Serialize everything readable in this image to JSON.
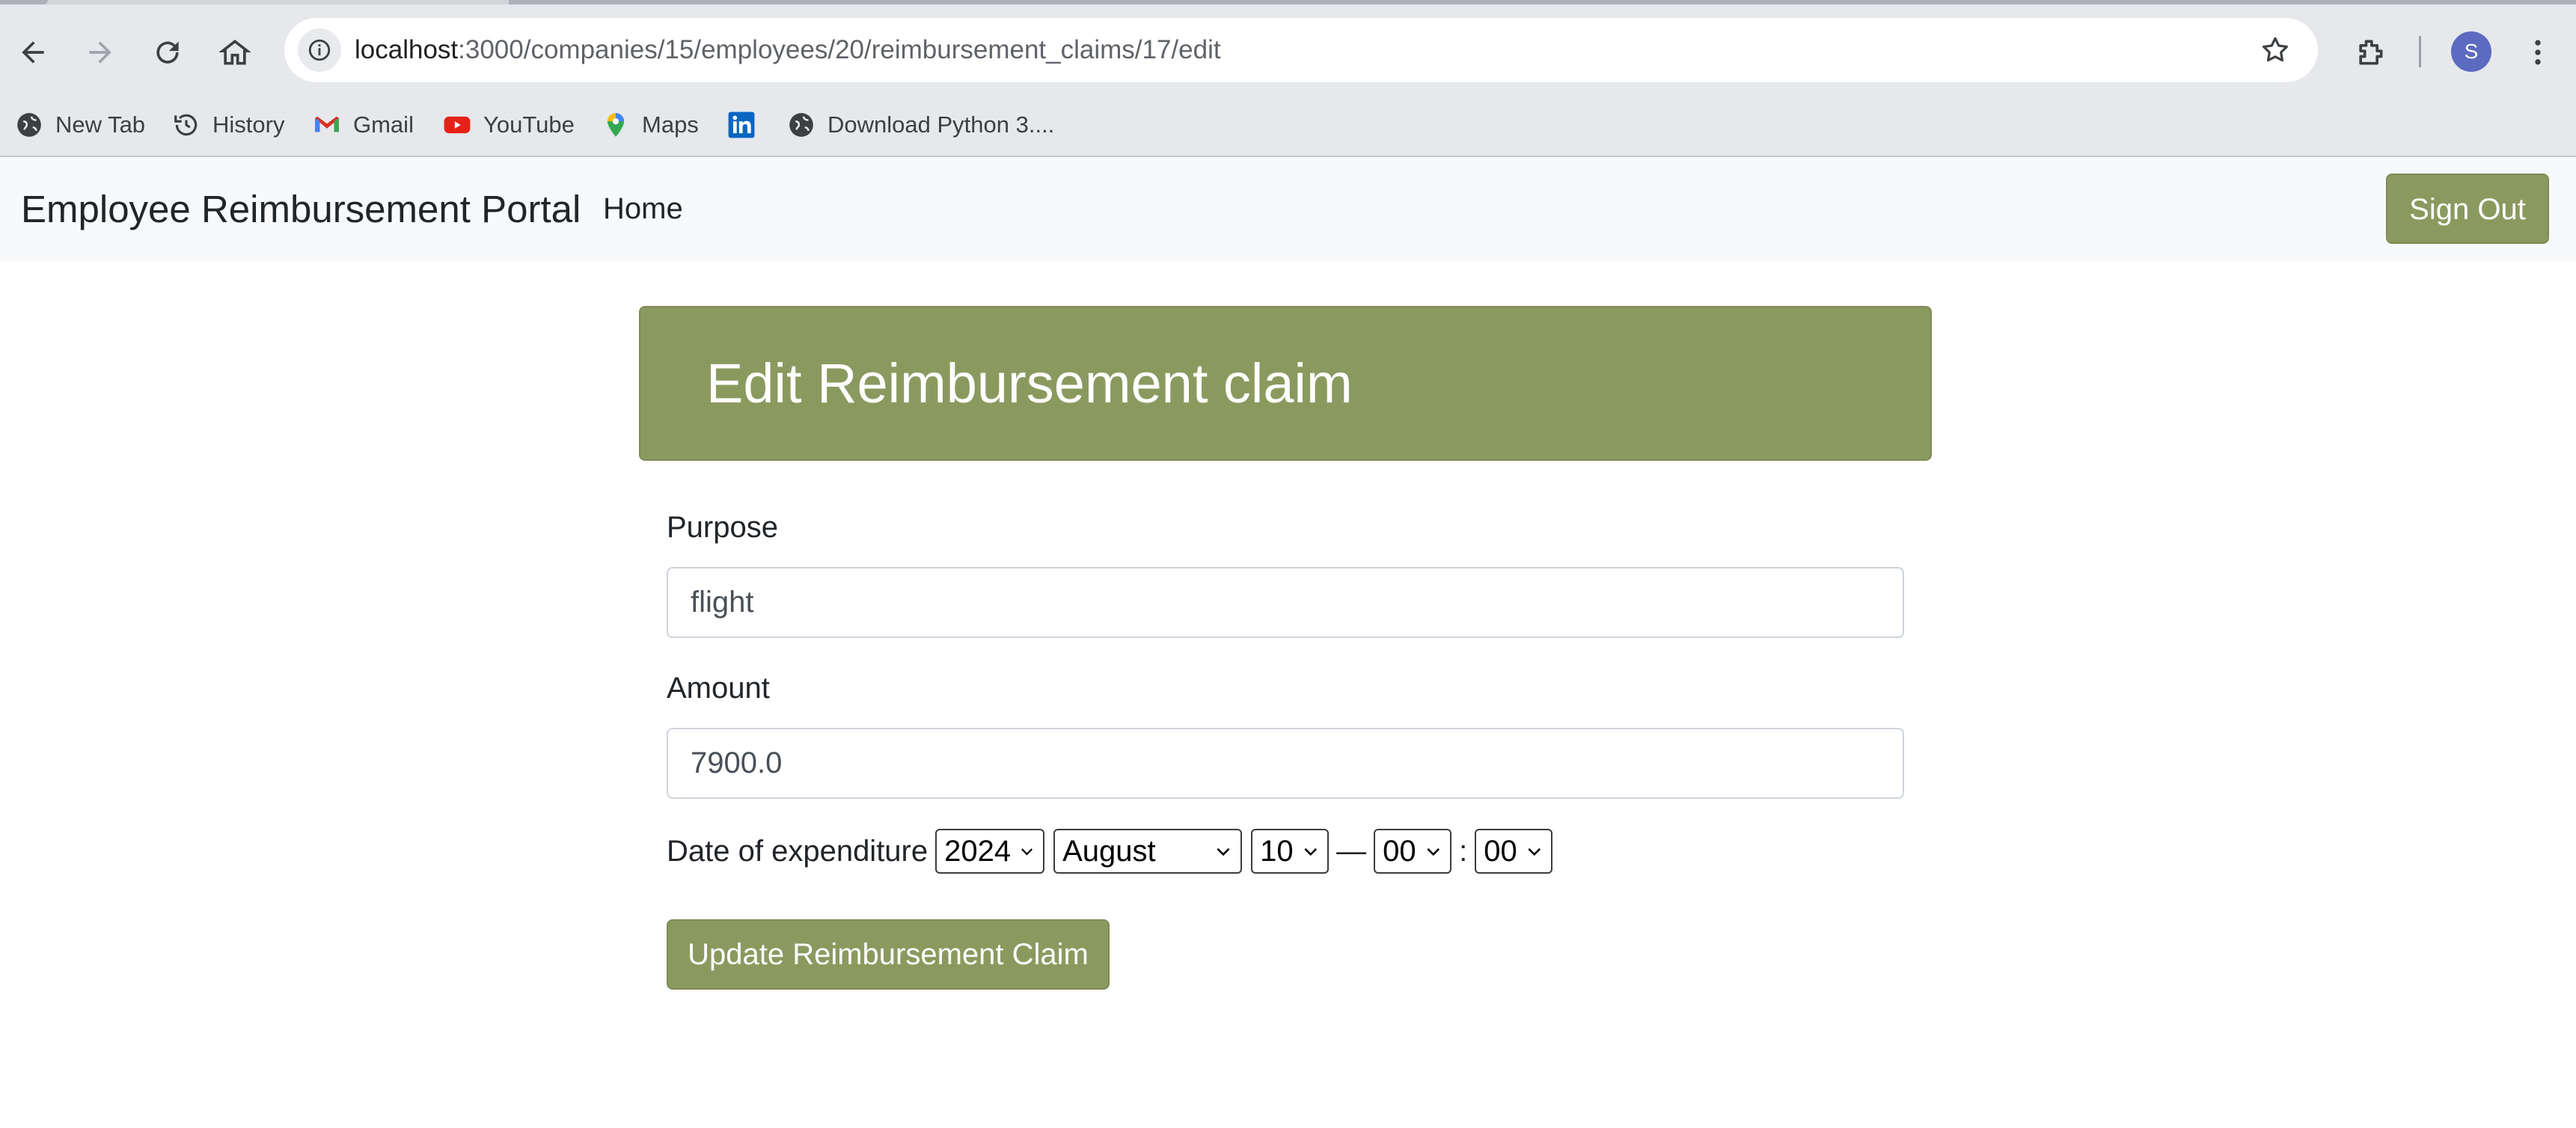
{
  "browser": {
    "url_host": "localhost",
    "url_path": ":3000/companies/15/employees/20/reimbursement_claims/17/edit",
    "profile_initial": "S",
    "bookmarks": [
      {
        "label": "New Tab",
        "icon": "globe-icon"
      },
      {
        "label": "History",
        "icon": "history-icon"
      },
      {
        "label": "Gmail",
        "icon": "gmail-icon"
      },
      {
        "label": "YouTube",
        "icon": "youtube-icon"
      },
      {
        "label": "Maps",
        "icon": "maps-icon"
      },
      {
        "label": "",
        "icon": "linkedin-icon"
      },
      {
        "label": "Download Python 3....",
        "icon": "globe-icon"
      }
    ]
  },
  "navbar": {
    "brand": "Employee Reimbursement Portal",
    "home": "Home",
    "sign_out": "Sign Out"
  },
  "form": {
    "title": "Edit Reimbursement claim",
    "purpose_label": "Purpose",
    "purpose_value": "flight",
    "amount_label": "Amount",
    "amount_value": "7900.0",
    "date_label": "Date of expenditure",
    "year": "2024",
    "month": "August",
    "day": "10",
    "dash": "—",
    "hour": "00",
    "colon": ":",
    "minute": "00",
    "submit": "Update Reimbursement Claim"
  },
  "colors": {
    "accent": "#8a9a5f",
    "navbar_bg": "#f8f9fa",
    "chrome_bg": "#e6e8ec"
  }
}
